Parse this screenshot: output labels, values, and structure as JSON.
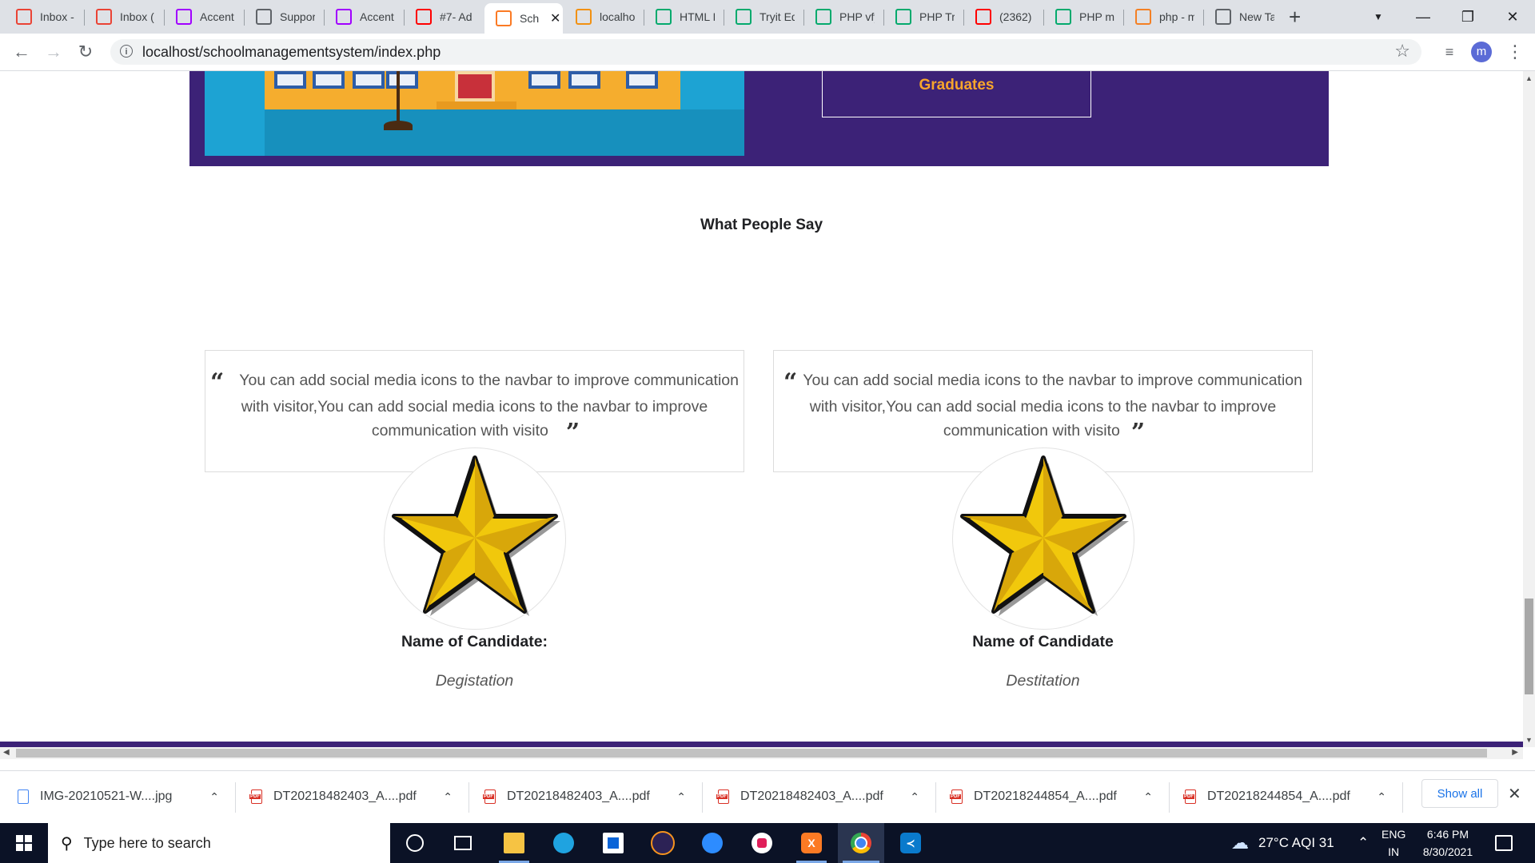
{
  "browser": {
    "tabs": [
      {
        "title": "Inbox -",
        "icon": "gmail-icon",
        "color": "#ea4335"
      },
      {
        "title": "Inbox (",
        "icon": "gmail-icon",
        "color": "#ea4335"
      },
      {
        "title": "Accent",
        "icon": "accenture-icon",
        "color": "#a100ff"
      },
      {
        "title": "Suppor",
        "icon": "globe-icon",
        "color": "#5f6368"
      },
      {
        "title": "Accent",
        "icon": "accenture-icon",
        "color": "#a100ff"
      },
      {
        "title": "#7- Ad",
        "icon": "youtube-icon",
        "color": "#ff0000"
      },
      {
        "title": "Sch",
        "icon": "xampp-icon",
        "color": "#fb7a24"
      },
      {
        "title": "localho",
        "icon": "phpmyadmin-icon",
        "color": "#f29111"
      },
      {
        "title": "HTML I",
        "icon": "w3schools-icon",
        "color": "#04aa6d"
      },
      {
        "title": "Tryit Ed",
        "icon": "w3schools-icon",
        "color": "#04aa6d"
      },
      {
        "title": "PHP vfy",
        "icon": "w3schools-icon",
        "color": "#04aa6d"
      },
      {
        "title": "PHP Try",
        "icon": "w3schools-icon",
        "color": "#04aa6d"
      },
      {
        "title": "(2362)",
        "icon": "youtube-icon",
        "color": "#ff0000"
      },
      {
        "title": "PHP my",
        "icon": "w3schools-icon",
        "color": "#04aa6d"
      },
      {
        "title": "php - m",
        "icon": "stackoverflow-icon",
        "color": "#f48024"
      },
      {
        "title": "New Ta",
        "icon": "chrome-icon",
        "color": "#5f6368"
      }
    ],
    "active_tab_index": 6,
    "url": "localhost/schoolmanagementsystem/index.php",
    "profile_initial": "m"
  },
  "page": {
    "hero": {
      "graduates_label": "Graduates"
    },
    "section_title": "What People Say",
    "testimonials": [
      {
        "quote": "You can add social media icons to the navbar to improve communication with visitor,You can add social media icons to the navbar to improve communication with visito",
        "name": "Name of Candidate:",
        "role": "Degistation"
      },
      {
        "quote": "You can add social media icons to the navbar to improve communication with visitor,You can add social media icons to the navbar to improve communication with visito",
        "name": "Name of Candidate",
        "role": "Destitation"
      }
    ],
    "colors": {
      "hero_bg": "#3c2277",
      "accent": "#f7a52b"
    }
  },
  "downloads": {
    "items": [
      {
        "name": "IMG-20210521-W....jpg",
        "type": "jpg"
      },
      {
        "name": "DT20218482403_A....pdf",
        "type": "pdf"
      },
      {
        "name": "DT20218482403_A....pdf",
        "type": "pdf"
      },
      {
        "name": "DT20218482403_A....pdf",
        "type": "pdf"
      },
      {
        "name": "DT20218244854_A....pdf",
        "type": "pdf"
      },
      {
        "name": "DT20218244854_A....pdf",
        "type": "pdf"
      }
    ],
    "show_all": "Show all"
  },
  "taskbar": {
    "search_placeholder": "Type here to search",
    "weather": "27°C  AQI 31",
    "lang_line1": "ENG",
    "lang_line2": "IN",
    "time": "6:46 PM",
    "date": "8/30/2021"
  }
}
